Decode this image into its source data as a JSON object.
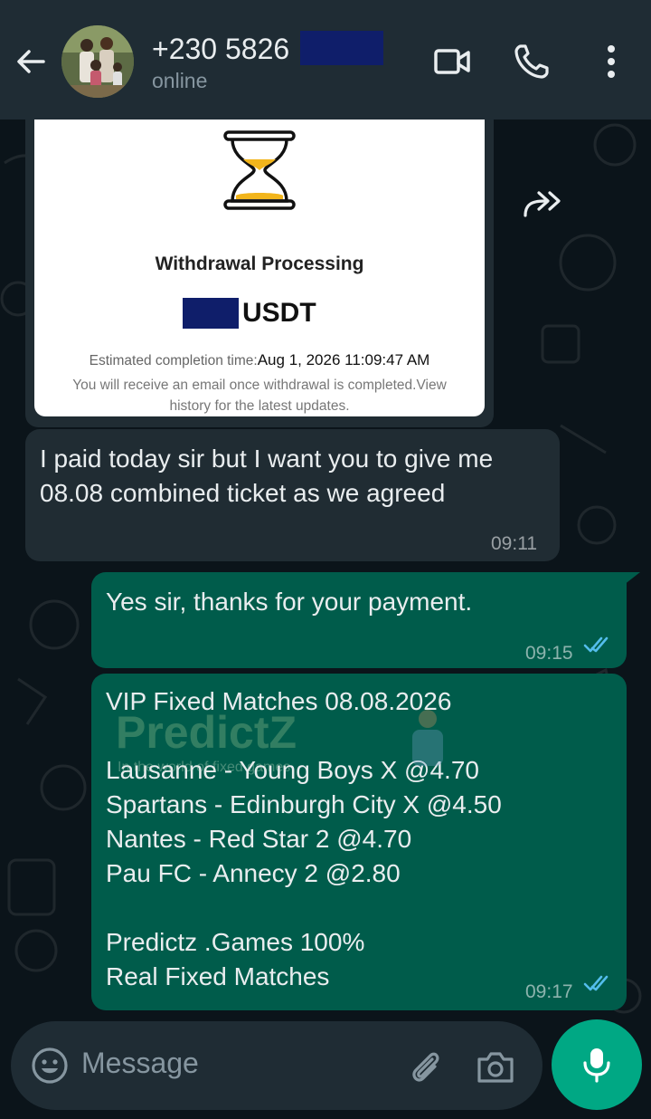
{
  "header": {
    "contact_name": "+230 5826",
    "status": "online"
  },
  "messages": {
    "image_card": {
      "title": "Withdrawal Processing",
      "amount_currency": "USDT",
      "estimated_label": "Estimated completion time:",
      "estimated_value": "Aug 1, 2026 11:09:47 AM",
      "note": "You will receive an email once withdrawal is completed.View history for the latest updates."
    },
    "incoming_1": {
      "text": "I paid today sir but I want you to give me 08.08 combined ticket as we agreed",
      "time": "09:11"
    },
    "outgoing_1": {
      "text": "Yes sir, thanks for your payment.",
      "time": "09:15"
    },
    "outgoing_2": {
      "text": "VIP Fixed Matches 08.08.2026\n\nLausanne - Young Boys  X  @4.70\nSpartans - Edinburgh City  X  @4.50\nNantes - Red Star  2  @4.70\nPau FC - Annecy  2  @2.80\n\nPredictz .Games 100%\nReal Fixed Matches",
      "time": "09:17",
      "watermark_text": "PredictZ",
      "watermark_sub": "In the world of fixed games"
    }
  },
  "composer": {
    "placeholder": "Message"
  },
  "colors": {
    "header_bg": "#1f2c34",
    "incoming_bubble": "#202c33",
    "outgoing_bubble": "#005c4b",
    "accent": "#00a884",
    "read_ticks": "#53bdeb"
  },
  "icons": [
    "back-arrow-icon",
    "video-call-icon",
    "voice-call-icon",
    "more-options-icon",
    "forward-icon",
    "double-check-icon",
    "emoji-icon",
    "attach-icon",
    "camera-icon",
    "microphone-icon",
    "hourglass-icon"
  ]
}
